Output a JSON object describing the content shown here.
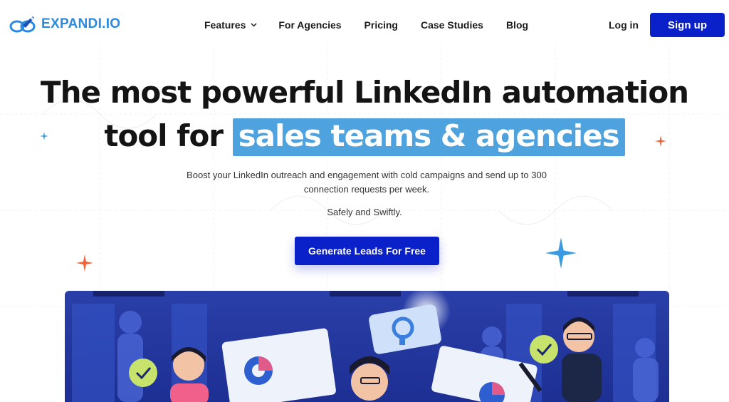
{
  "brand": {
    "name": "EXPANDI.IO",
    "icon": "rocket-cloud-logo",
    "color": "#2a8ae0"
  },
  "nav": {
    "items": [
      {
        "label": "Features",
        "has_dropdown": true
      },
      {
        "label": "For Agencies"
      },
      {
        "label": "Pricing"
      },
      {
        "label": "Case Studies"
      },
      {
        "label": "Blog"
      }
    ]
  },
  "auth": {
    "login_label": "Log in",
    "signup_label": "Sign up"
  },
  "hero": {
    "title_line1": "The most powerful LinkedIn automation",
    "title_line2_prefix": "tool for",
    "title_highlight": "sales teams & agencies",
    "subtitle": "Boost your LinkedIn outreach and engagement with cold campaigns and send up to 300 connection requests per week.",
    "tagline": "Safely and Swiftly.",
    "cta_label": "Generate Leads For Free"
  },
  "colors": {
    "accent": "#0a20c9",
    "highlight": "#4ea3de",
    "sparkle_orange": "#f0643c",
    "sparkle_blue": "#3a9be0"
  }
}
